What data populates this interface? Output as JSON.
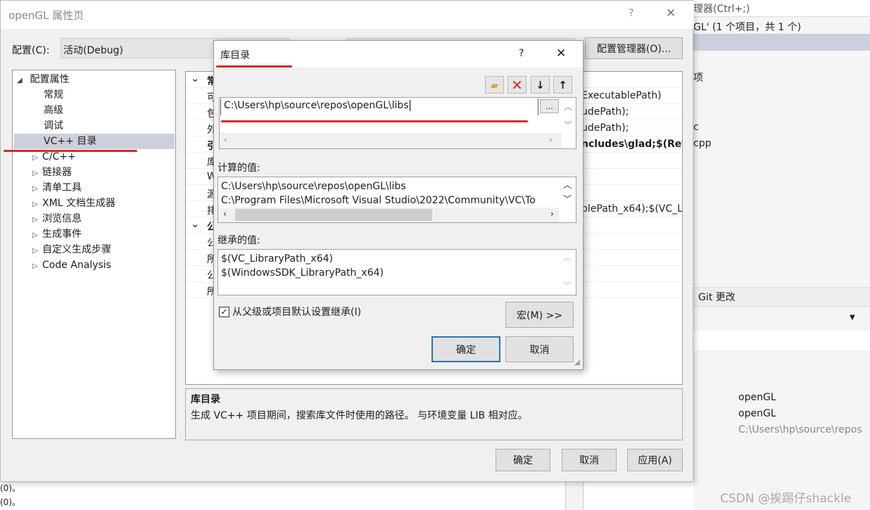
{
  "background_ide": {
    "search_partial": "理器(Ctrl+;)",
    "solution_partial": "GL' (1 个项目，共 1 个)",
    "tree_partials": [
      "项",
      "c",
      "cpp"
    ],
    "git_changes_tab": "Git 更改",
    "properties_values": [
      "openGL",
      "openGL",
      "C:\\Users\\hp\\source\\repos"
    ],
    "output_lines": [
      "(0)。",
      "(0)。"
    ],
    "watermark": "CSDN @挨踢仔shackle"
  },
  "property_window": {
    "title": "openGL 属性页",
    "help_label": "?",
    "close_label": "✕",
    "config_label": "配置(C):",
    "config_value": "活动(Debug)",
    "config_manager_button": "配置管理器(O)...",
    "tree": [
      {
        "label": "配置属性",
        "expanded": true,
        "level": 0
      },
      {
        "label": "常规",
        "level": 1
      },
      {
        "label": "高级",
        "level": 1
      },
      {
        "label": "调试",
        "level": 1
      },
      {
        "label": "VC++ 目录",
        "level": 1,
        "selected": true
      },
      {
        "label": "C/C++",
        "level": 1,
        "collapsed": true
      },
      {
        "label": "链接器",
        "level": 1,
        "collapsed": true
      },
      {
        "label": "清单工具",
        "level": 1,
        "collapsed": true
      },
      {
        "label": "XML 文档生成器",
        "level": 1,
        "collapsed": true
      },
      {
        "label": "浏览信息",
        "level": 1,
        "collapsed": true
      },
      {
        "label": "生成事件",
        "level": 1,
        "collapsed": true
      },
      {
        "label": "自定义生成步骤",
        "level": 1,
        "collapsed": true
      },
      {
        "label": "Code Analysis",
        "level": 1,
        "collapsed": true
      }
    ],
    "grid_rows": [
      {
        "name": "常",
        "value": "",
        "bold": true,
        "group": true
      },
      {
        "name": "可",
        "value": "ExecutablePath)"
      },
      {
        "name": "包",
        "value": "udePath);"
      },
      {
        "name": "外",
        "value": "udePath);"
      },
      {
        "name": "引",
        "value": "ncludes\\glad;$(Refe",
        "bold": true
      },
      {
        "name": "库",
        "value": ""
      },
      {
        "name": "W",
        "value": ""
      },
      {
        "name": "源",
        "value": ""
      },
      {
        "name": "排",
        "value": "blePath_x64);$(VC_L"
      },
      {
        "name": "公",
        "value": "",
        "bold": true,
        "group": true
      },
      {
        "name": "公",
        "value": ""
      },
      {
        "name": "所",
        "value": ""
      },
      {
        "name": "公",
        "value": ""
      },
      {
        "name": "所",
        "value": ""
      }
    ],
    "description_title": "库目录",
    "description_text": "生成 VC++ 项目期间，搜索库文件时使用的路径。 与环境变量 LIB 相对应。",
    "ok_button": "确定",
    "cancel_button": "取消",
    "apply_button": "应用(A)"
  },
  "dialog": {
    "title": "库目录",
    "help_label": "?",
    "close_label": "✕",
    "toolbar": [
      "new-folder-icon",
      "delete-icon",
      "move-down-icon",
      "move-up-icon"
    ],
    "entry_value": "C:\\Users\\hp\\source\\repos\\openGL\\libs",
    "browse_button": "...",
    "computed_label": "计算的值:",
    "computed_lines": [
      "C:\\Users\\hp\\source\\repos\\openGL\\libs",
      "C:\\Program Files\\Microsoft Visual Studio\\2022\\Community\\VC\\To"
    ],
    "inherited_label": "继承的值:",
    "inherited_lines": [
      "$(VC_LibraryPath_x64)",
      "$(WindowsSDK_LibraryPath_x64)"
    ],
    "inherit_checkbox_label": "从父级或项目默认设置继承(I)",
    "inherit_checked": true,
    "macro_button": "宏(M) >>",
    "ok_button": "确定",
    "cancel_button": "取消",
    "annotation_color": "#d42a2a"
  }
}
